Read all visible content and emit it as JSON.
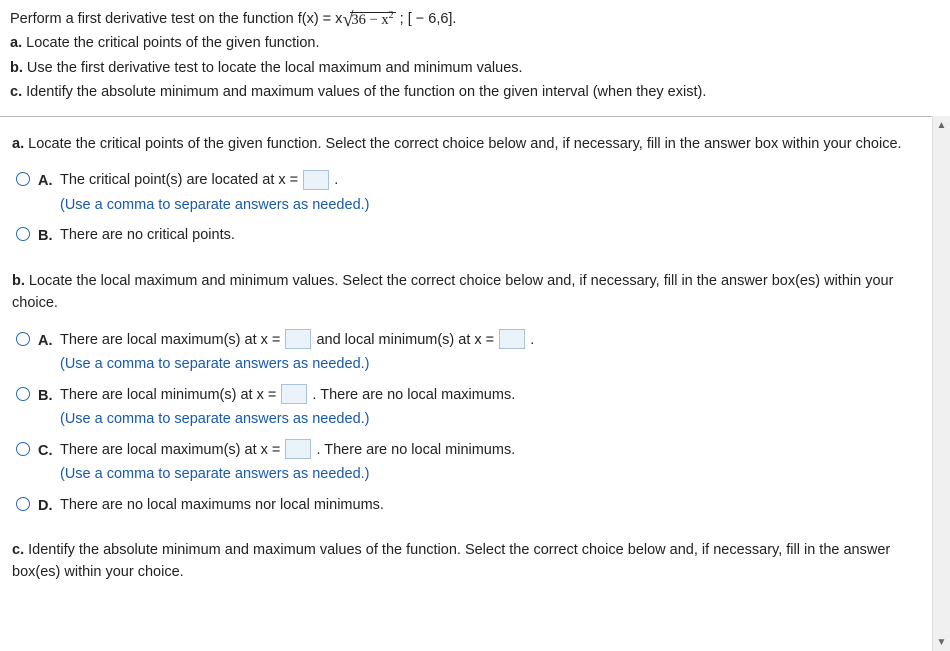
{
  "header": {
    "intro_pre": "Perform a first derivative test on the function f(x) = x",
    "intro_radicand_a": "36 − x",
    "intro_radicand_exp": "2",
    "intro_post": " ; [ − 6,6].",
    "a": "Locate the critical points of the given function.",
    "b": "Use the first derivative test to locate the local maximum and minimum values.",
    "c": "Identify the absolute minimum and maximum values of the function on the given interval (when they exist)."
  },
  "partA": {
    "prompt": "Locate the critical points of the given function. Select the correct choice below and, if necessary, fill in the answer box within your choice.",
    "A": {
      "text_pre": "The critical point(s) are located at x =",
      "text_post": ".",
      "hint": "(Use a comma to separate answers as needed.)"
    },
    "B": {
      "text": "There are no critical points."
    }
  },
  "partB": {
    "prompt": "Locate the local maximum and minimum values. Select the correct choice below and, if necessary, fill in the answer box(es) within your choice.",
    "A": {
      "t1": "There are local maximum(s) at x =",
      "t2": " and local minimum(s) at x =",
      "t3": ".",
      "hint": "(Use a comma to separate answers as needed.)"
    },
    "B": {
      "t1": "There are local minimum(s) at x =",
      "t2": ". There are no local maximums.",
      "hint": "(Use a comma to separate answers as needed.)"
    },
    "C": {
      "t1": "There are local maximum(s) at x =",
      "t2": ". There are no local minimums.",
      "hint": "(Use a comma to separate answers as needed.)"
    },
    "D": {
      "text": "There are no local maximums nor local minimums."
    }
  },
  "partC": {
    "prompt": "Identify the absolute minimum and maximum values of the function. Select the correct choice below and, if necessary, fill in the answer box(es) within your choice."
  },
  "labels": {
    "a": "a.",
    "b": "b.",
    "c": "c.",
    "A": "A.",
    "B": "B.",
    "C": "C.",
    "D": "D."
  }
}
